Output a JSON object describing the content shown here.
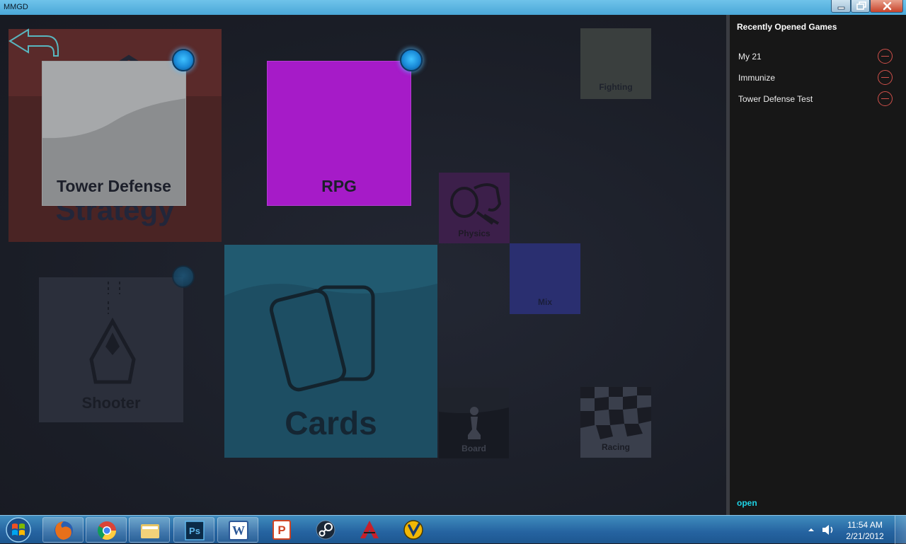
{
  "window": {
    "title": "MMGD"
  },
  "colors": {
    "accent_cyan": "#1ed4e6",
    "remove_red": "#d0504a",
    "rpg_purple": "#a61bc8",
    "strategy_red": "#6a2a2a",
    "cards_teal": "#1d4e63",
    "mix_blue": "#2a2f70"
  },
  "tiles": {
    "strategy": {
      "label": "Strategy",
      "icon": "bat-icon"
    },
    "tower_defense": {
      "label": "Tower Defense",
      "selected": true
    },
    "rpg": {
      "label": "RPG",
      "selected": true
    },
    "fighting": {
      "label": "Fighting"
    },
    "physics": {
      "label": "Physics",
      "icon": "slingshot-icon"
    },
    "mix": {
      "label": "Mix"
    },
    "shooter": {
      "label": "Shooter",
      "icon": "spaceship-icon",
      "selected": false
    },
    "cards": {
      "label": "Cards",
      "icon": "cards-icon"
    },
    "board": {
      "label": "Board",
      "icon": "chess-pawn-icon"
    },
    "racing": {
      "label": "Racing",
      "icon": "checkered-flag-icon"
    }
  },
  "sidebar": {
    "header": "Recently Opened Games",
    "items": [
      {
        "name": "My 21"
      },
      {
        "name": "Immunize"
      },
      {
        "name": "Tower Defense Test"
      }
    ],
    "open_label": "open"
  },
  "taskbar": {
    "apps": [
      "firefox-icon",
      "chrome-icon",
      "explorer-folder-icon",
      "photoshop-icon",
      "word-icon",
      "powerpoint-icon",
      "steam-icon",
      "autodesk-icon",
      "app-icon"
    ],
    "photoshop_label": "Ps",
    "word_label": "W",
    "powerpoint_label": "P",
    "time": "11:54 AM",
    "date": "2/21/2012"
  }
}
